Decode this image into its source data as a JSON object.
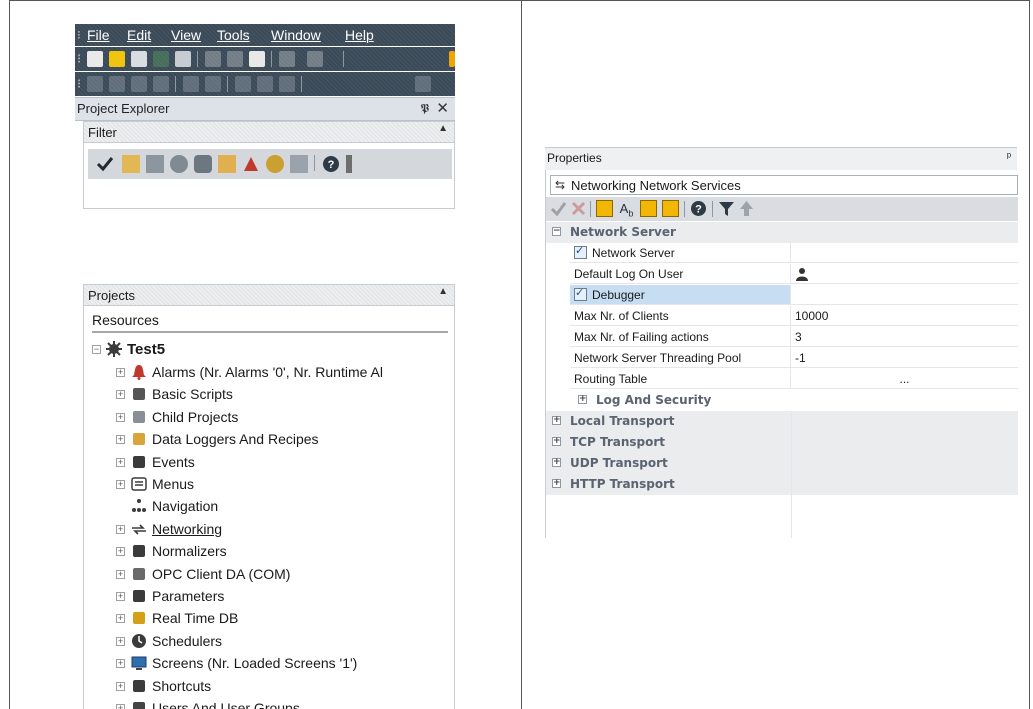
{
  "menu": [
    "File",
    "Edit",
    "View",
    "Tools",
    "Window",
    "Help"
  ],
  "project_explorer": {
    "title": "Project Explorer",
    "pin": "ᵖ",
    "close": "×",
    "filter_label": "Filter",
    "projects_label": "Projects",
    "resources_label": "Resources",
    "root": "Test5",
    "items": [
      {
        "label": "Alarms (Nr. Alarms '0', Nr. Runtime Al",
        "icon": "alarm-bell-icon",
        "expandable": true
      },
      {
        "label": "Basic Scripts",
        "icon": "script-icon",
        "expandable": true
      },
      {
        "label": "Child Projects",
        "icon": "child-projects-icon",
        "expandable": true
      },
      {
        "label": "Data Loggers And Recipes",
        "icon": "database-icon",
        "expandable": true
      },
      {
        "label": "Events",
        "icon": "events-icon",
        "expandable": true
      },
      {
        "label": "Menus",
        "icon": "menu-icon",
        "expandable": true
      },
      {
        "label": "Navigation",
        "icon": "navigation-icon",
        "expandable": false
      },
      {
        "label": "Networking",
        "icon": "networking-arrows-icon",
        "expandable": true,
        "link": true
      },
      {
        "label": "Normalizers",
        "icon": "normalizer-icon",
        "expandable": true
      },
      {
        "label": "OPC Client DA (COM)",
        "icon": "opc-client-icon",
        "expandable": true
      },
      {
        "label": "Parameters",
        "icon": "parameters-icon",
        "expandable": true
      },
      {
        "label": "Real Time DB",
        "icon": "realtime-db-icon",
        "expandable": true
      },
      {
        "label": "Schedulers",
        "icon": "clock-icon",
        "expandable": true
      },
      {
        "label": "Screens (Nr. Loaded Screens '1')",
        "icon": "monitor-icon",
        "expandable": true
      },
      {
        "label": "Shortcuts",
        "icon": "shortcut-icon",
        "expandable": true
      },
      {
        "label": "Users And User Groups",
        "icon": "users-icon",
        "expandable": true
      }
    ]
  },
  "properties": {
    "title": "Properties",
    "pin": "ᵖ",
    "selected_object": "Networking Network Services",
    "rows": [
      {
        "type": "category",
        "label": "Network Server",
        "expanded": true
      },
      {
        "type": "prop",
        "name": "Network Server",
        "checkbox": true,
        "value": ""
      },
      {
        "type": "prop",
        "name": "Default Log On User",
        "value": "",
        "value_icon": "user-icon"
      },
      {
        "type": "prop",
        "name": "Debugger",
        "checkbox": true,
        "value": "",
        "selected": true
      },
      {
        "type": "prop",
        "name": "Max Nr. of Clients",
        "value": "10000"
      },
      {
        "type": "prop",
        "name": "Max Nr. of Failing actions",
        "value": "3"
      },
      {
        "type": "prop",
        "name": "Network Server Threading Pool",
        "value": "-1"
      },
      {
        "type": "prop",
        "name": "Routing Table",
        "value": "..."
      },
      {
        "type": "subcategory",
        "label": "Log And Security",
        "expanded": false
      },
      {
        "type": "category",
        "label": "Local Transport",
        "expanded": false
      },
      {
        "type": "category",
        "label": "TCP Transport",
        "expanded": false
      },
      {
        "type": "category",
        "label": "UDP Transport",
        "expanded": false
      },
      {
        "type": "category",
        "label": "HTTP Transport",
        "expanded": false
      }
    ]
  },
  "colors": {
    "alarm": "#c0392b",
    "toolbar_bg": "#3b4a58",
    "accent_yellow": "#f2b705",
    "selection": "#c7ddf2"
  }
}
